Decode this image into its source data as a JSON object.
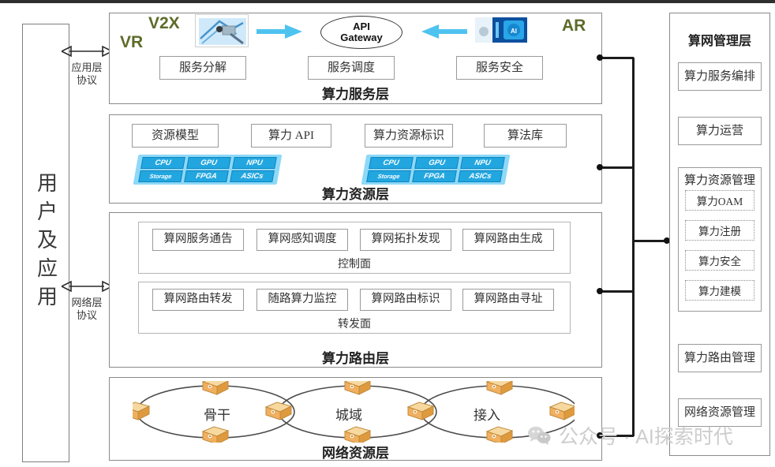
{
  "left_column": {
    "label": "用户及应用",
    "protocols": [
      {
        "name": "应用层协议",
        "line1": "应用层",
        "line2": "协议"
      },
      {
        "name": "网络层协议",
        "line1": "网络层",
        "line2": "协议"
      }
    ]
  },
  "layers": [
    {
      "id": "service",
      "title": "算力服务层",
      "tags": [
        "VR",
        "V2X",
        "AR"
      ],
      "gateway": {
        "line1": "API",
        "line2": "Gateway"
      },
      "boxes": [
        "服务分解",
        "服务调度",
        "服务安全"
      ],
      "thumbs": [
        "network-device-photo",
        "ai-chip-photo"
      ],
      "arrows": [
        "arrow-right-to-gateway",
        "arrow-left-to-gateway"
      ]
    },
    {
      "id": "resource",
      "title": "算力资源层",
      "boxes": [
        "资源模型",
        "算力 API",
        "算力资源标识",
        "算法库"
      ],
      "chip_groups": [
        {
          "row1": [
            "CPU",
            "GPU",
            "NPU"
          ],
          "row2": [
            "Storage",
            "FPGA",
            "ASICs"
          ]
        },
        {
          "row1": [
            "CPU",
            "GPU",
            "NPU"
          ],
          "row2": [
            "Storage",
            "FPGA",
            "ASICs"
          ]
        }
      ]
    },
    {
      "id": "routing",
      "title": "算力路由层",
      "planes": [
        {
          "label": "控制面",
          "boxes": [
            "算网服务通告",
            "算网感知调度",
            "算网拓扑发现",
            "算网路由生成"
          ]
        },
        {
          "label": "转发面",
          "boxes": [
            "算网路由转发",
            "随路算力监控",
            "算网路由标识",
            "算网路由寻址"
          ]
        }
      ]
    },
    {
      "id": "network",
      "title": "网络资源层",
      "rings": [
        "骨干",
        "城域",
        "接入"
      ]
    }
  ],
  "sidebar": {
    "title": "算网管理层",
    "items": [
      {
        "label": "算力服务编排",
        "children": []
      },
      {
        "label": "算力运营",
        "children": []
      },
      {
        "label": "算力资源管理",
        "children": [
          "算力OAM",
          "算力注册",
          "算力安全",
          "算力建模"
        ]
      },
      {
        "label": "算力路由管理",
        "children": []
      },
      {
        "label": "网络资源管理",
        "children": []
      }
    ]
  },
  "watermark": {
    "text": "公众号 · AI探索时代",
    "icon": "wechat-icon"
  },
  "colors": {
    "chip_fill": "#22a6e0",
    "chip_backing": "#8ed8f8",
    "arrow_blue": "#4fc3f0",
    "tag_olive": "#5d6b28",
    "router_orange": "#f0b060",
    "border_gray": "#8a8a8a",
    "watermark_gray": "#cdcdcd"
  }
}
